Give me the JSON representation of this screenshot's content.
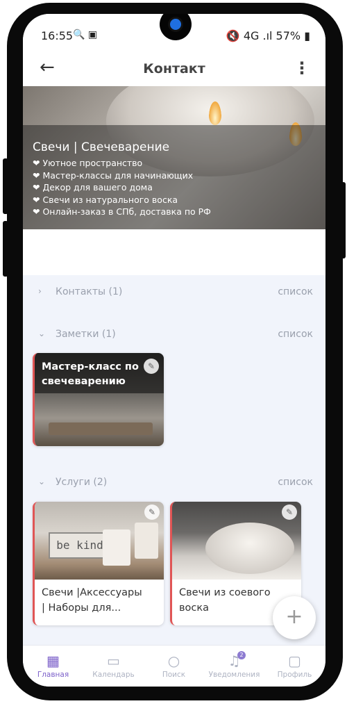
{
  "status": {
    "time": "16:55",
    "left_icons": "🔍 ▣",
    "right": "🔇 4G .ıl 57% ▮"
  },
  "appbar": {
    "title": "Контакт",
    "back_icon": "←",
    "menu_icon": "⋮"
  },
  "hero": {
    "title": "Свечи | Свечеварение",
    "lines": [
      "❤ Уютное пространство",
      "❤ Мастер-классы для начинающих",
      "❤ Декор для вашего дома",
      "❤ Свечи из натурального воска",
      "❤ Онлайн-заказ в СПб, доставка по РФ"
    ]
  },
  "sections": {
    "contacts": {
      "chevron": "›",
      "name": "Контакты (1)",
      "action": "список"
    },
    "notes": {
      "chevron": "⌄",
      "name": "Заметки (1)",
      "action": "список"
    },
    "services": {
      "chevron": "⌄",
      "name": "Услуги (2)",
      "action": "список"
    }
  },
  "note_card": {
    "title": "Мастер-класс по свечеварению"
  },
  "service_cards": [
    {
      "title_line1": "Свечи |Аксессуары",
      "title_line2": "| Наборы для...",
      "image_text": "be kind"
    },
    {
      "title_line1": "Свечи из соевого",
      "title_line2": "воска"
    }
  ],
  "pin_icon": "✎",
  "fab": {
    "label": "+"
  },
  "nav": [
    {
      "label": "Главная",
      "icon": "▦"
    },
    {
      "label": "Календарь",
      "icon": "▭"
    },
    {
      "label": "Поиск",
      "icon": "○"
    },
    {
      "label": "Уведомления",
      "icon": "♫",
      "badge": "2"
    },
    {
      "label": "Профиль",
      "icon": "▢"
    }
  ],
  "colors": {
    "accent": "#7b5fc9",
    "card_border": "#e05555",
    "background": "#f1f4fb"
  }
}
